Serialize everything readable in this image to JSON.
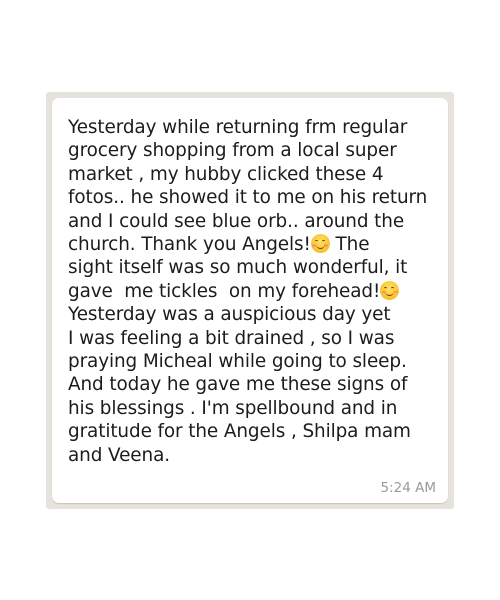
{
  "message": {
    "lines": [
      "Yesterday while returning frm regular",
      "grocery shopping from a local super",
      "market , my hubby clicked these 4",
      "fotos.. he showed it to me on his return",
      "and I could see blue orb.. around the",
      "church. Thank you Angels!",
      " The",
      "sight itself was so much wonderful, it",
      "gave  me tickles  on my forehead!",
      "Yesterday was a auspicious day yet",
      "I was feeling a bit drained , so I was",
      "praying Micheal while going to sleep.",
      "And today he gave me these signs of",
      "his blessings . I'm spellbound and in",
      "gratitude for the Angels , Shilpa mam",
      "and Veena."
    ],
    "emoji": "smiling-face-with-smiling-eyes-icon",
    "time": "5:24 AM"
  },
  "colors": {
    "background": "#e6e2dc",
    "bubble": "#ffffff",
    "text": "#1c1c1c",
    "timestamp": "#9a9a9a"
  }
}
